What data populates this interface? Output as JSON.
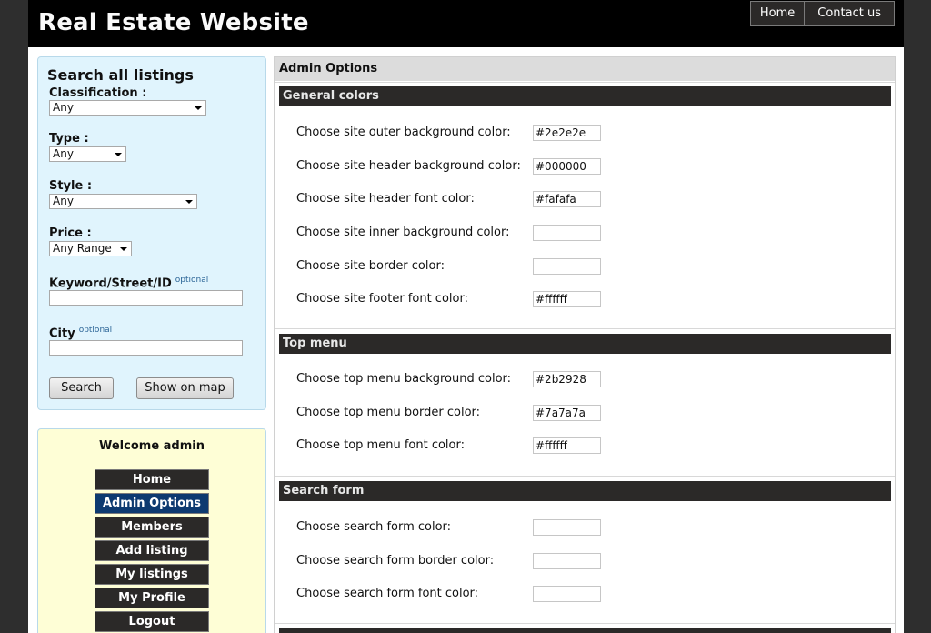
{
  "site": {
    "title": "Real Estate Website"
  },
  "topmenu": {
    "items": [
      "Home",
      "Contact us"
    ]
  },
  "search": {
    "title": "Search all listings",
    "classification_label": "Classification :",
    "classification_value": "Any",
    "type_label": "Type :",
    "type_value": "Any",
    "style_label": "Style :",
    "style_value": "Any",
    "price_label": "Price :",
    "price_value": "Any Range",
    "keyword_label": "Keyword/Street/ID",
    "keyword_optional": "optional",
    "keyword_value": "",
    "city_label": "City",
    "city_optional": "optional",
    "city_value": "",
    "search_button": "Search",
    "map_button": "Show on map"
  },
  "user": {
    "welcome": "Welcome admin",
    "menu": [
      "Home",
      "Admin Options",
      "Members",
      "Add listing",
      "My listings",
      "My Profile",
      "Logout"
    ],
    "active": "Admin Options"
  },
  "admin": {
    "title": "Admin Options",
    "sections": [
      {
        "title": "General colors",
        "options": [
          {
            "label": "Choose site outer background color:",
            "value": "#2e2e2e"
          },
          {
            "label": "Choose site header background color:",
            "value": "#000000"
          },
          {
            "label": "Choose site header font color:",
            "value": "#fafafa"
          },
          {
            "label": "Choose site inner background color:",
            "value": ""
          },
          {
            "label": "Choose site border color:",
            "value": ""
          },
          {
            "label": "Choose site footer font color:",
            "value": "#ffffff"
          }
        ]
      },
      {
        "title": "Top menu",
        "options": [
          {
            "label": "Choose top menu background color:",
            "value": "#2b2928"
          },
          {
            "label": "Choose top menu border color:",
            "value": "#7a7a7a"
          },
          {
            "label": "Choose top menu font color:",
            "value": "#ffffff"
          }
        ]
      },
      {
        "title": "Search form",
        "options": [
          {
            "label": "Choose search form color:",
            "value": ""
          },
          {
            "label": "Choose search form border color:",
            "value": ""
          },
          {
            "label": "Choose search form font color:",
            "value": ""
          }
        ]
      }
    ]
  },
  "colors": {
    "outer_background": "#2e2e2e",
    "header_background": "#000000",
    "menu_background": "#2b2928",
    "menu_active": "#0d3a70",
    "search_box_background": "#e0f4fd",
    "welcome_box_background": "#fefed6"
  }
}
